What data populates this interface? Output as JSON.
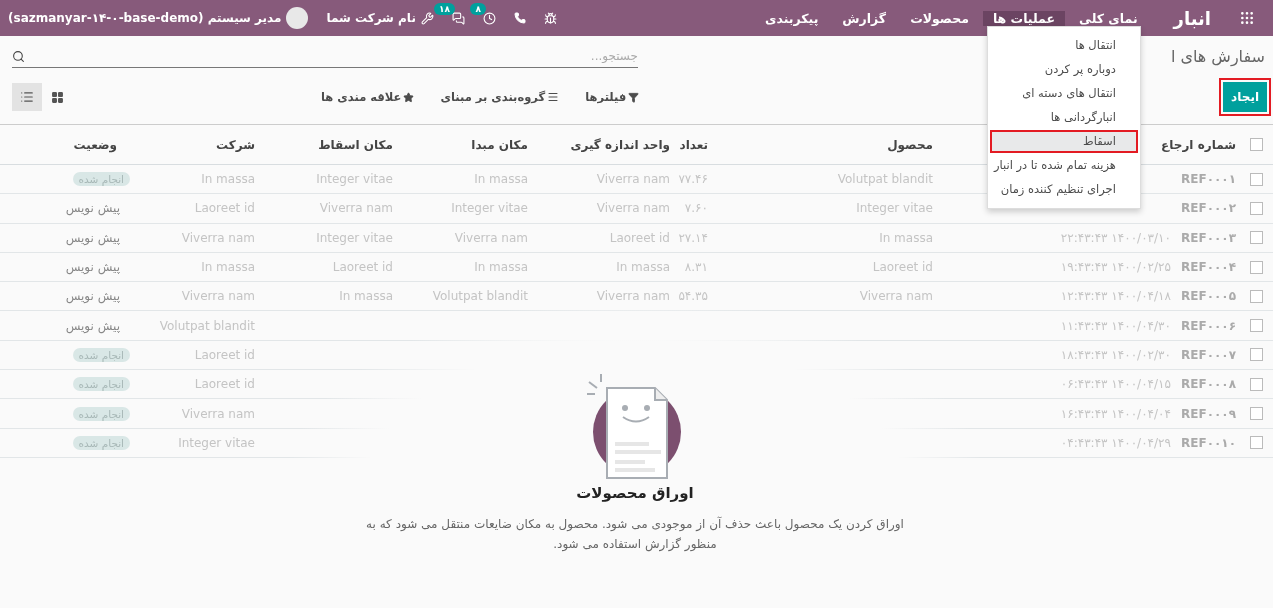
{
  "navbar": {
    "app_name": "انبار",
    "menu": [
      {
        "label": "نمای کلی",
        "selected": false
      },
      {
        "label": "عملیات ها",
        "selected": true
      },
      {
        "label": "محصولات",
        "selected": false
      },
      {
        "label": "گزارش",
        "selected": false
      },
      {
        "label": "پیکربندی",
        "selected": false
      }
    ],
    "activity_badge": "۸",
    "messages_badge": "۱۸",
    "company": "نام شرکت شما",
    "user": "مدیر سیستم (sazmanyar-۱۴-۰-base-demo)"
  },
  "dropdown": {
    "items": [
      {
        "label": "انتقال ها",
        "selected": false,
        "highlighted": false
      },
      {
        "label": "دوباره پر کردن",
        "selected": false,
        "highlighted": false
      },
      {
        "label": "انتقال های دسته ای",
        "selected": false,
        "highlighted": false
      },
      {
        "label": "انبارگردانی ها",
        "selected": false,
        "highlighted": false
      },
      {
        "label": "اسقاط",
        "selected": true,
        "highlighted": true
      },
      {
        "label": "هزینه تمام شده تا در انبار",
        "selected": false,
        "highlighted": false
      },
      {
        "label": "اجرای تنظیم کننده زمان",
        "selected": false,
        "highlighted": false
      }
    ]
  },
  "control_panel": {
    "title": "سفارش های ا",
    "search": {
      "placeholder": "جستجو..."
    },
    "create_button": {
      "label": "ایجاد",
      "highlighted": true
    },
    "filters": [
      {
        "kind": "filter",
        "label": "فیلترها"
      },
      {
        "kind": "group",
        "label": "گروه‌بندی بر مبنای"
      },
      {
        "kind": "favorite",
        "label": "علاقه مندی ها"
      }
    ],
    "views": [
      {
        "kind": "list",
        "selected": true
      },
      {
        "kind": "kanban",
        "selected": false
      }
    ]
  },
  "table": {
    "select_all_checked": false,
    "columns": [
      {
        "label": "شماره ارجاع"
      },
      {},
      {
        "label": "محصول"
      },
      {
        "label": "تعداد"
      },
      {
        "label": "واحد اندازه گیری"
      },
      {
        "label": "مکان مبدا"
      },
      {
        "label": "مکان اسقاط"
      },
      {
        "label": "شرکت"
      },
      {
        "label": "وضعیت"
      }
    ],
    "rows": [
      {
        "checked": false,
        "ref": "REF۰۰۰۱",
        "product": "Volutpat blandit",
        "quantity": "۷۷.۴۶",
        "unit": "Viverra nam",
        "source": "In massa",
        "destination": "Integer vitae",
        "company": "In massa",
        "status": {
          "kind": "done",
          "text": "انجام شده"
        }
      },
      {
        "checked": false,
        "ref": "REF۰۰۰۲",
        "product": "Integer vitae",
        "quantity": "۷.۶۰",
        "unit": "Viverra nam",
        "source": "Integer vitae",
        "destination": "Viverra nam",
        "company": "Laoreet id",
        "status": {
          "kind": "draft",
          "text": "پیش نویس"
        }
      },
      {
        "checked": false,
        "ref": "REF۰۰۰۳",
        "date": "۲۲:۴۳:۴۳ ۱۴۰۰/۰۳/۱۰",
        "product": "In massa",
        "quantity": "۲۷.۱۴",
        "unit": "Laoreet id",
        "source": "Viverra nam",
        "destination": "Integer vitae",
        "company": "Viverra nam",
        "status": {
          "kind": "draft",
          "text": "پیش نویس"
        }
      },
      {
        "checked": false,
        "ref": "REF۰۰۰۴",
        "date": "۱۹:۴۳:۴۳ ۱۴۰۰/۰۲/۲۵",
        "product": "Laoreet id",
        "quantity": "۸.۳۱",
        "unit": "In massa",
        "source": "In massa",
        "destination": "Laoreet id",
        "company": "In massa",
        "status": {
          "kind": "draft",
          "text": "پیش نویس"
        }
      },
      {
        "checked": false,
        "ref": "REF۰۰۰۵",
        "date": "۱۲:۴۳:۴۳ ۱۴۰۰/۰۴/۱۸",
        "product": "Viverra nam",
        "quantity": "۵۴.۳۵",
        "unit": "Viverra nam",
        "source": "Volutpat blandit",
        "destination": "In massa",
        "company": "Viverra nam",
        "status": {
          "kind": "draft",
          "text": "پیش نویس"
        }
      },
      {
        "checked": false,
        "ref": "REF۰۰۰۶",
        "date": "۱۱:۴۳:۴۳ ۱۴۰۰/۰۴/۳۰",
        "company": "Volutpat blandit",
        "status": {
          "kind": "draft",
          "text": "پیش نویس"
        }
      },
      {
        "checked": false,
        "ref": "REF۰۰۰۷",
        "date": "۱۸:۴۳:۴۳ ۱۴۰۰/۰۲/۳۰",
        "company": "Laoreet id",
        "status": {
          "kind": "done",
          "text": "انجام شده"
        }
      },
      {
        "checked": false,
        "ref": "REF۰۰۰۸",
        "date": "۰۶:۴۳:۴۳ ۱۴۰۰/۰۴/۱۵",
        "company": "Laoreet id",
        "status": {
          "kind": "done",
          "text": "انجام شده"
        }
      },
      {
        "checked": false,
        "ref": "REF۰۰۰۹",
        "date": "۱۶:۴۳:۴۳ ۱۴۰۰/۰۴/۰۴",
        "company": "Viverra nam",
        "status": {
          "kind": "done",
          "text": "انجام شده"
        }
      },
      {
        "checked": false,
        "ref": "REF۰۰۱۰",
        "date": "۰۴:۴۳:۴۳ ۱۴۰۰/۰۴/۲۹",
        "company": "Integer vitae",
        "status": {
          "kind": "done",
          "text": "انجام شده"
        }
      }
    ]
  },
  "empty_state": {
    "title": "اوراق محصولات",
    "description": "اوراق کردن یک محصول باعث حذف آن از موجودی می شود. محصول به مکان ضایعات منتقل می شود که به منظور گزارش استفاده می شود."
  }
}
